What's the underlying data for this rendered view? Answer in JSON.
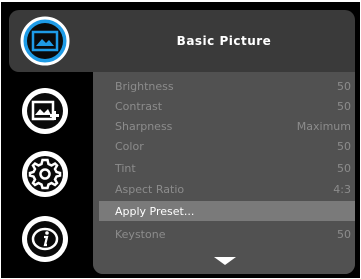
{
  "panel": {
    "title": "Basic Picture"
  },
  "sidebar": {
    "items": [
      {
        "icon": "picture-icon",
        "selected": true
      },
      {
        "icon": "advanced-picture-icon",
        "selected": false
      },
      {
        "icon": "settings-gear-icon",
        "selected": false
      },
      {
        "icon": "info-icon",
        "selected": false
      }
    ]
  },
  "menu": {
    "rows": [
      {
        "label": "Brightness",
        "value": "50"
      },
      {
        "label": "Contrast",
        "value": "50"
      },
      {
        "label": "Sharpness",
        "value": "Maximum"
      },
      {
        "label": "Color",
        "value": "50"
      },
      {
        "label": "Tint",
        "value": "50"
      },
      {
        "label": "Aspect Ratio",
        "value": "4:3"
      },
      {
        "label": "Apply Preset...",
        "value": ""
      },
      {
        "label": "Keystone",
        "value": "50"
      }
    ],
    "selected_index": 6
  },
  "colors": {
    "accent_blue": "#1e9be6",
    "panel_bg": "#3a3a3a",
    "menu_bg": "#515151",
    "highlight": "#7a7a7a"
  }
}
